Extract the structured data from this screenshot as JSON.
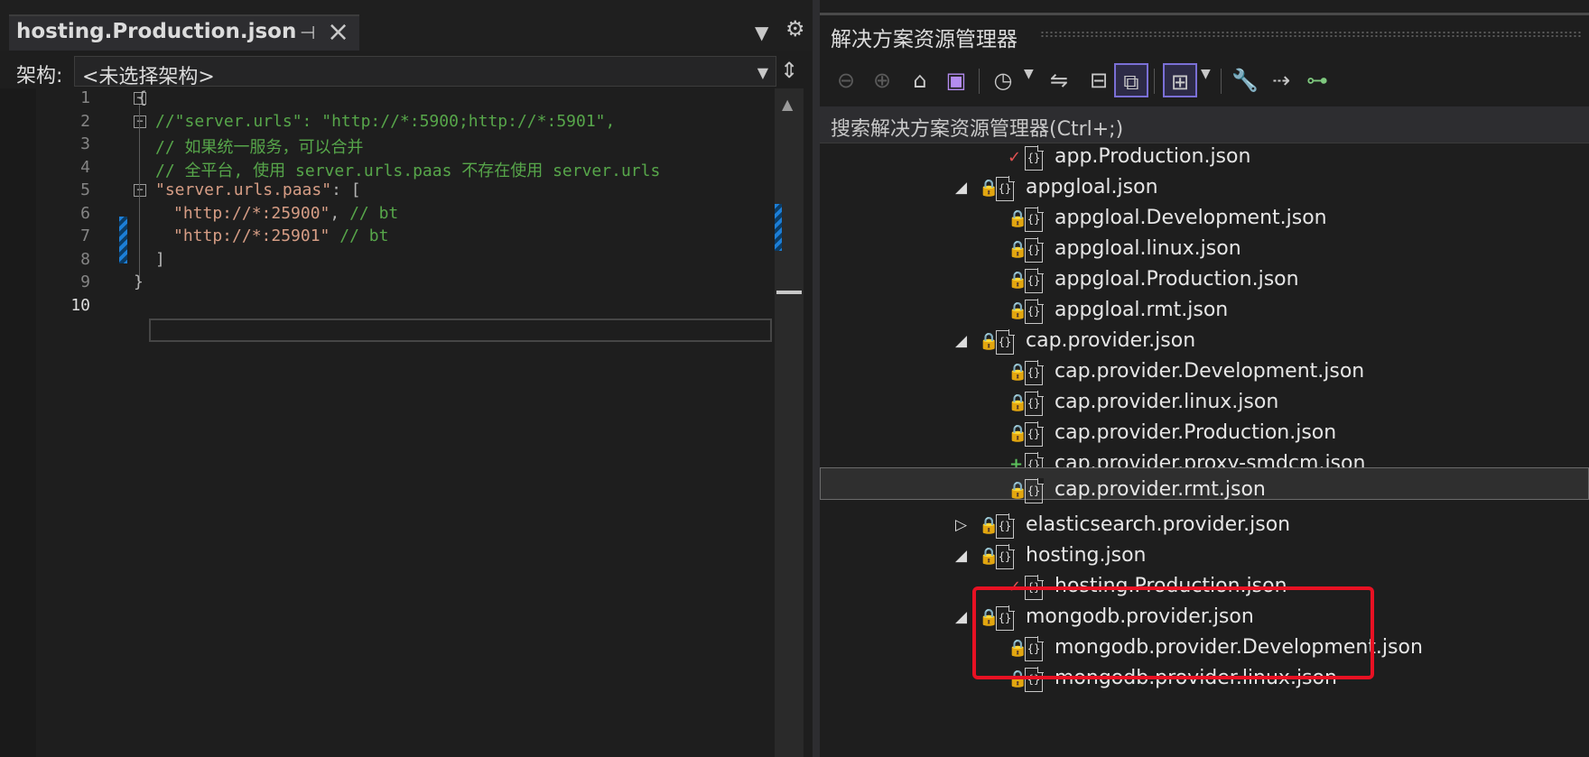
{
  "editor": {
    "tab_title": "hosting.Production.json",
    "nav_label": "架构:",
    "nav_value": "<未选择架构>",
    "line_numbers": [
      "1",
      "2",
      "3",
      "4",
      "5",
      "6",
      "7",
      "8",
      "9",
      "10"
    ],
    "code": {
      "l1": "{",
      "l2": "//\"server.urls\": \"http://*:5900;http://*:5901\",",
      "l3": "// 如果统一服务，可以合并",
      "l4": "// 全平台, 使用 server.urls.paas 不存在使用 server.urls",
      "l5_key": "\"server.urls.paas\"",
      "l5_punc": ": [",
      "l6_str": "\"http://*:25900\"",
      "l6_punc": ",",
      "l6_comment": " // bt",
      "l7_str": "\"http://*:25901\"",
      "l7_comment": " // bt",
      "l8": "]",
      "l9": "}"
    },
    "icons": {
      "pin": "pin-icon",
      "close": "close-icon",
      "dropdown": "chevron-down-icon",
      "settings": "gear-icon",
      "split": "split-icon"
    }
  },
  "explorer": {
    "title": "解决方案资源管理器",
    "search_placeholder": "搜索解决方案资源管理器(Ctrl+;)",
    "toolbar": [
      "back-icon",
      "forward-icon",
      "home-icon",
      "vs-solution-icon",
      "history-icon",
      "sync-icon",
      "collapse-all-icon",
      "show-all-files-icon",
      "view-switcher-icon",
      "properties-wrench-icon",
      "preview-icon",
      "class-view-icon"
    ],
    "tree": [
      {
        "label": "app.Production.json",
        "status": "✓",
        "expander": ""
      },
      {
        "label": "appgloal.json",
        "status": "🔒",
        "expander": "◢"
      },
      {
        "label": "appgloal.Development.json",
        "status": "🔒",
        "expander": ""
      },
      {
        "label": "appgloal.linux.json",
        "status": "🔒",
        "expander": ""
      },
      {
        "label": "appgloal.Production.json",
        "status": "🔒",
        "expander": ""
      },
      {
        "label": "appgloal.rmt.json",
        "status": "🔒",
        "expander": ""
      },
      {
        "label": "cap.provider.json",
        "status": "🔒",
        "expander": "◢"
      },
      {
        "label": "cap.provider.Development.json",
        "status": "🔒",
        "expander": ""
      },
      {
        "label": "cap.provider.linux.json",
        "status": "🔒",
        "expander": ""
      },
      {
        "label": "cap.provider.Production.json",
        "status": "🔒",
        "expander": ""
      },
      {
        "label": "cap.provider.proxy-smdcm.json",
        "status": "+",
        "expander": ""
      },
      {
        "label": "cap.provider.rmt.json",
        "status": "🔒",
        "expander": ""
      },
      {
        "label": "elasticsearch.provider.json",
        "status": "🔒",
        "expander": "▷"
      },
      {
        "label": "hosting.json",
        "status": "🔒",
        "expander": "◢"
      },
      {
        "label": "hosting.Production.json",
        "status": "✓",
        "expander": ""
      },
      {
        "label": "mongodb.provider.json",
        "status": "🔒",
        "expander": "◢"
      },
      {
        "label": "mongodb.provider.Development.json",
        "status": "🔒",
        "expander": ""
      },
      {
        "label": "mongodb.provider.linux.json",
        "status": "🔒",
        "expander": ""
      }
    ],
    "file_icon_glyph": "{}"
  },
  "colors": {
    "highlight": "#e81123",
    "comment": "#57a64a",
    "string": "#d69d85",
    "lock": "#6ea8fe"
  }
}
